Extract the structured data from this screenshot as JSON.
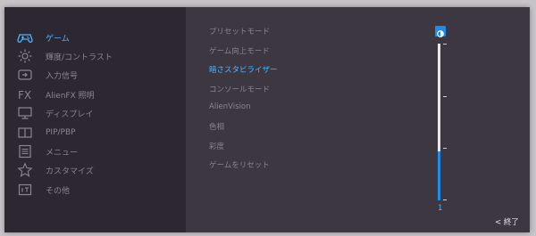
{
  "colors": {
    "accent": "#4fb2ff",
    "text": "#8b8590",
    "panel": "#2c2730",
    "panel_right": "#3d3741"
  },
  "sidebar": {
    "items": [
      {
        "label": "ゲーム",
        "icon": "gamepad-icon",
        "active": true
      },
      {
        "label": "輝度/コントラスト",
        "icon": "brightness-icon",
        "active": false
      },
      {
        "label": "入力信号",
        "icon": "input-source-icon",
        "active": false
      },
      {
        "label": "AlienFX 照明",
        "icon": "fx-icon",
        "active": false
      },
      {
        "label": "ディスプレイ",
        "icon": "monitor-icon",
        "active": false
      },
      {
        "label": "PIP/PBP",
        "icon": "pip-icon",
        "active": false
      },
      {
        "label": "メニュー",
        "icon": "menu-icon",
        "active": false
      },
      {
        "label": "カスタマイズ",
        "icon": "star-icon",
        "active": false
      },
      {
        "label": "その他",
        "icon": "other-icon",
        "active": false
      }
    ]
  },
  "submenu": {
    "items": [
      {
        "label": "プリセットモード",
        "active": false
      },
      {
        "label": "ゲーム向上モード",
        "active": false
      },
      {
        "label": "暗さスタビライザー",
        "active": true
      },
      {
        "label": "コンソールモード",
        "active": false
      },
      {
        "label": "AlienVision",
        "active": false
      },
      {
        "label": "色相",
        "active": false
      },
      {
        "label": "彩度",
        "active": false
      },
      {
        "label": "ゲームをリセット",
        "active": false
      }
    ]
  },
  "slider": {
    "value": "1",
    "fraction": 0.31,
    "icon": "stabilizer-icon"
  },
  "footer": {
    "exit_label": "< 終了"
  }
}
